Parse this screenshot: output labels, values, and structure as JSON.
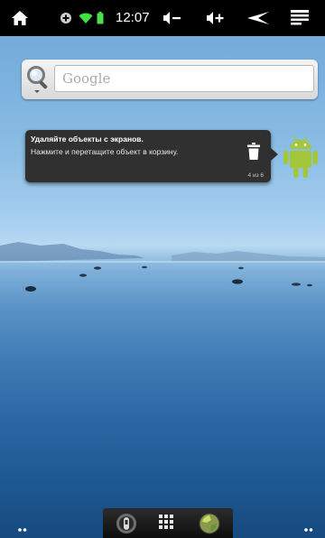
{
  "status_bar": {
    "time": "12:07",
    "icons": [
      "home-icon",
      "usb-debug-icon",
      "wifi-icon",
      "battery-icon",
      "volume-down-icon",
      "volume-up-icon",
      "back-icon",
      "menu-icon"
    ]
  },
  "search": {
    "placeholder": "Google",
    "icon": "search-icon"
  },
  "tooltip": {
    "title": "Удаляйте объекты с экранов.",
    "body": "Нажмите и перетащите объект в корзину.",
    "counter": "4 из 6",
    "icon": "trash-icon"
  },
  "dock": {
    "buttons": [
      "phone-icon",
      "all-apps-icon",
      "browser-icon"
    ]
  },
  "colors": {
    "status_bar_bg": "#000000",
    "tooltip_bg": "#303030",
    "android_green": "#a4c639"
  }
}
